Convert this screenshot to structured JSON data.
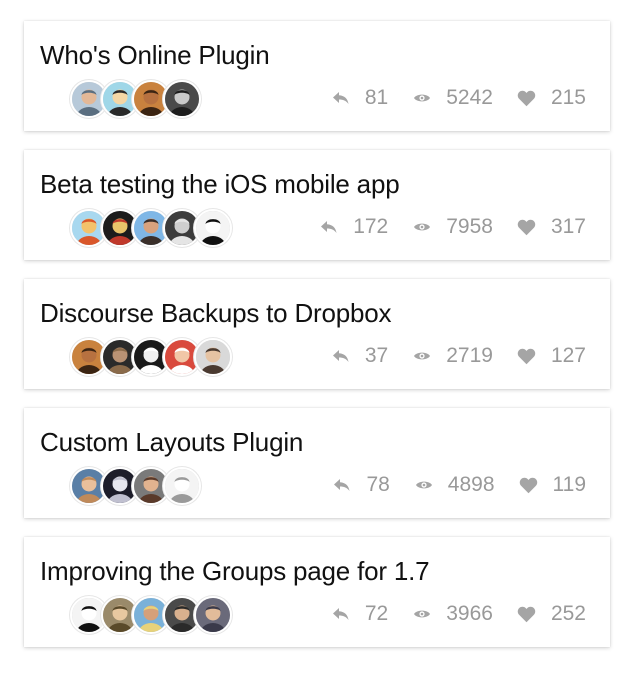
{
  "colors": {
    "text": "#111111",
    "muted": "#999999",
    "card_bg": "#ffffff"
  },
  "stat_icons": [
    "reply-icon",
    "eye-icon",
    "heart-icon"
  ],
  "topics": [
    {
      "title": "Who's Online Plugin",
      "avatars": [
        {
          "bg": "#b7c9d9",
          "fg": "#5a6e80",
          "skin": "#e3b897"
        },
        {
          "bg": "#9fd7e8",
          "fg": "#2a2a2a",
          "skin": "#f4d7a5"
        },
        {
          "bg": "#c9823e",
          "fg": "#3b2412",
          "skin": "#b77140"
        },
        {
          "bg": "#4a4a4a",
          "fg": "#1d1d1d",
          "skin": "#c9c9c9"
        }
      ],
      "replies": "81",
      "views": "5242",
      "likes": "215"
    },
    {
      "title": "Beta testing the iOS mobile app",
      "avatars": [
        {
          "bg": "#a8d8ef",
          "fg": "#d9572a",
          "skin": "#f3c26b"
        },
        {
          "bg": "#1c1c1c",
          "fg": "#c0392b",
          "skin": "#e9c46a"
        },
        {
          "bg": "#7fb7e6",
          "fg": "#3a2f2a",
          "skin": "#d8a27d"
        },
        {
          "bg": "#3c3c3c",
          "fg": "#e5e5e5",
          "skin": "#cfcfcf"
        },
        {
          "bg": "#f4f4f4",
          "fg": "#111111",
          "skin": "#ffffff"
        }
      ],
      "replies": "172",
      "views": "7958",
      "likes": "317"
    },
    {
      "title": "Discourse Backups to Dropbox",
      "avatars": [
        {
          "bg": "#c9823e",
          "fg": "#3b2412",
          "skin": "#b77140"
        },
        {
          "bg": "#2a2a2a",
          "fg": "#8a6a4a",
          "skin": "#b99274"
        },
        {
          "bg": "#1a1a1a",
          "fg": "#ffffff",
          "skin": "#f0f0f0"
        },
        {
          "bg": "#d94a3d",
          "fg": "#ffffff",
          "skin": "#f1c7a7"
        },
        {
          "bg": "#d9d9d9",
          "fg": "#4a3a30",
          "skin": "#e6c3a3"
        }
      ],
      "replies": "37",
      "views": "2719",
      "likes": "127"
    },
    {
      "title": "Custom Layouts Plugin",
      "avatars": [
        {
          "bg": "#5a7fa6",
          "fg": "#c08a5a",
          "skin": "#e9bf9b"
        },
        {
          "bg": "#1d1d2a",
          "fg": "#c0c0d0",
          "skin": "#e8e8f0"
        },
        {
          "bg": "#7a7a7a",
          "fg": "#5a3a2a",
          "skin": "#e2b38f"
        },
        {
          "bg": "#f4f4f4",
          "fg": "#9a9a9a",
          "skin": "#ffffff"
        }
      ],
      "replies": "78",
      "views": "4898",
      "likes": "119"
    },
    {
      "title": "Improving the Groups page for 1.7",
      "avatars": [
        {
          "bg": "#f4f4f4",
          "fg": "#111111",
          "skin": "#ffffff"
        },
        {
          "bg": "#9a8a6a",
          "fg": "#5a4a2a",
          "skin": "#e8c8a0"
        },
        {
          "bg": "#7ab1d9",
          "fg": "#e8d27a",
          "skin": "#d6a07a"
        },
        {
          "bg": "#4a4a4a",
          "fg": "#2a2a2a",
          "skin": "#d8b08e"
        },
        {
          "bg": "#6a6a7a",
          "fg": "#3a3a4a",
          "skin": "#e2bc9a"
        }
      ],
      "replies": "72",
      "views": "3966",
      "likes": "252"
    }
  ]
}
